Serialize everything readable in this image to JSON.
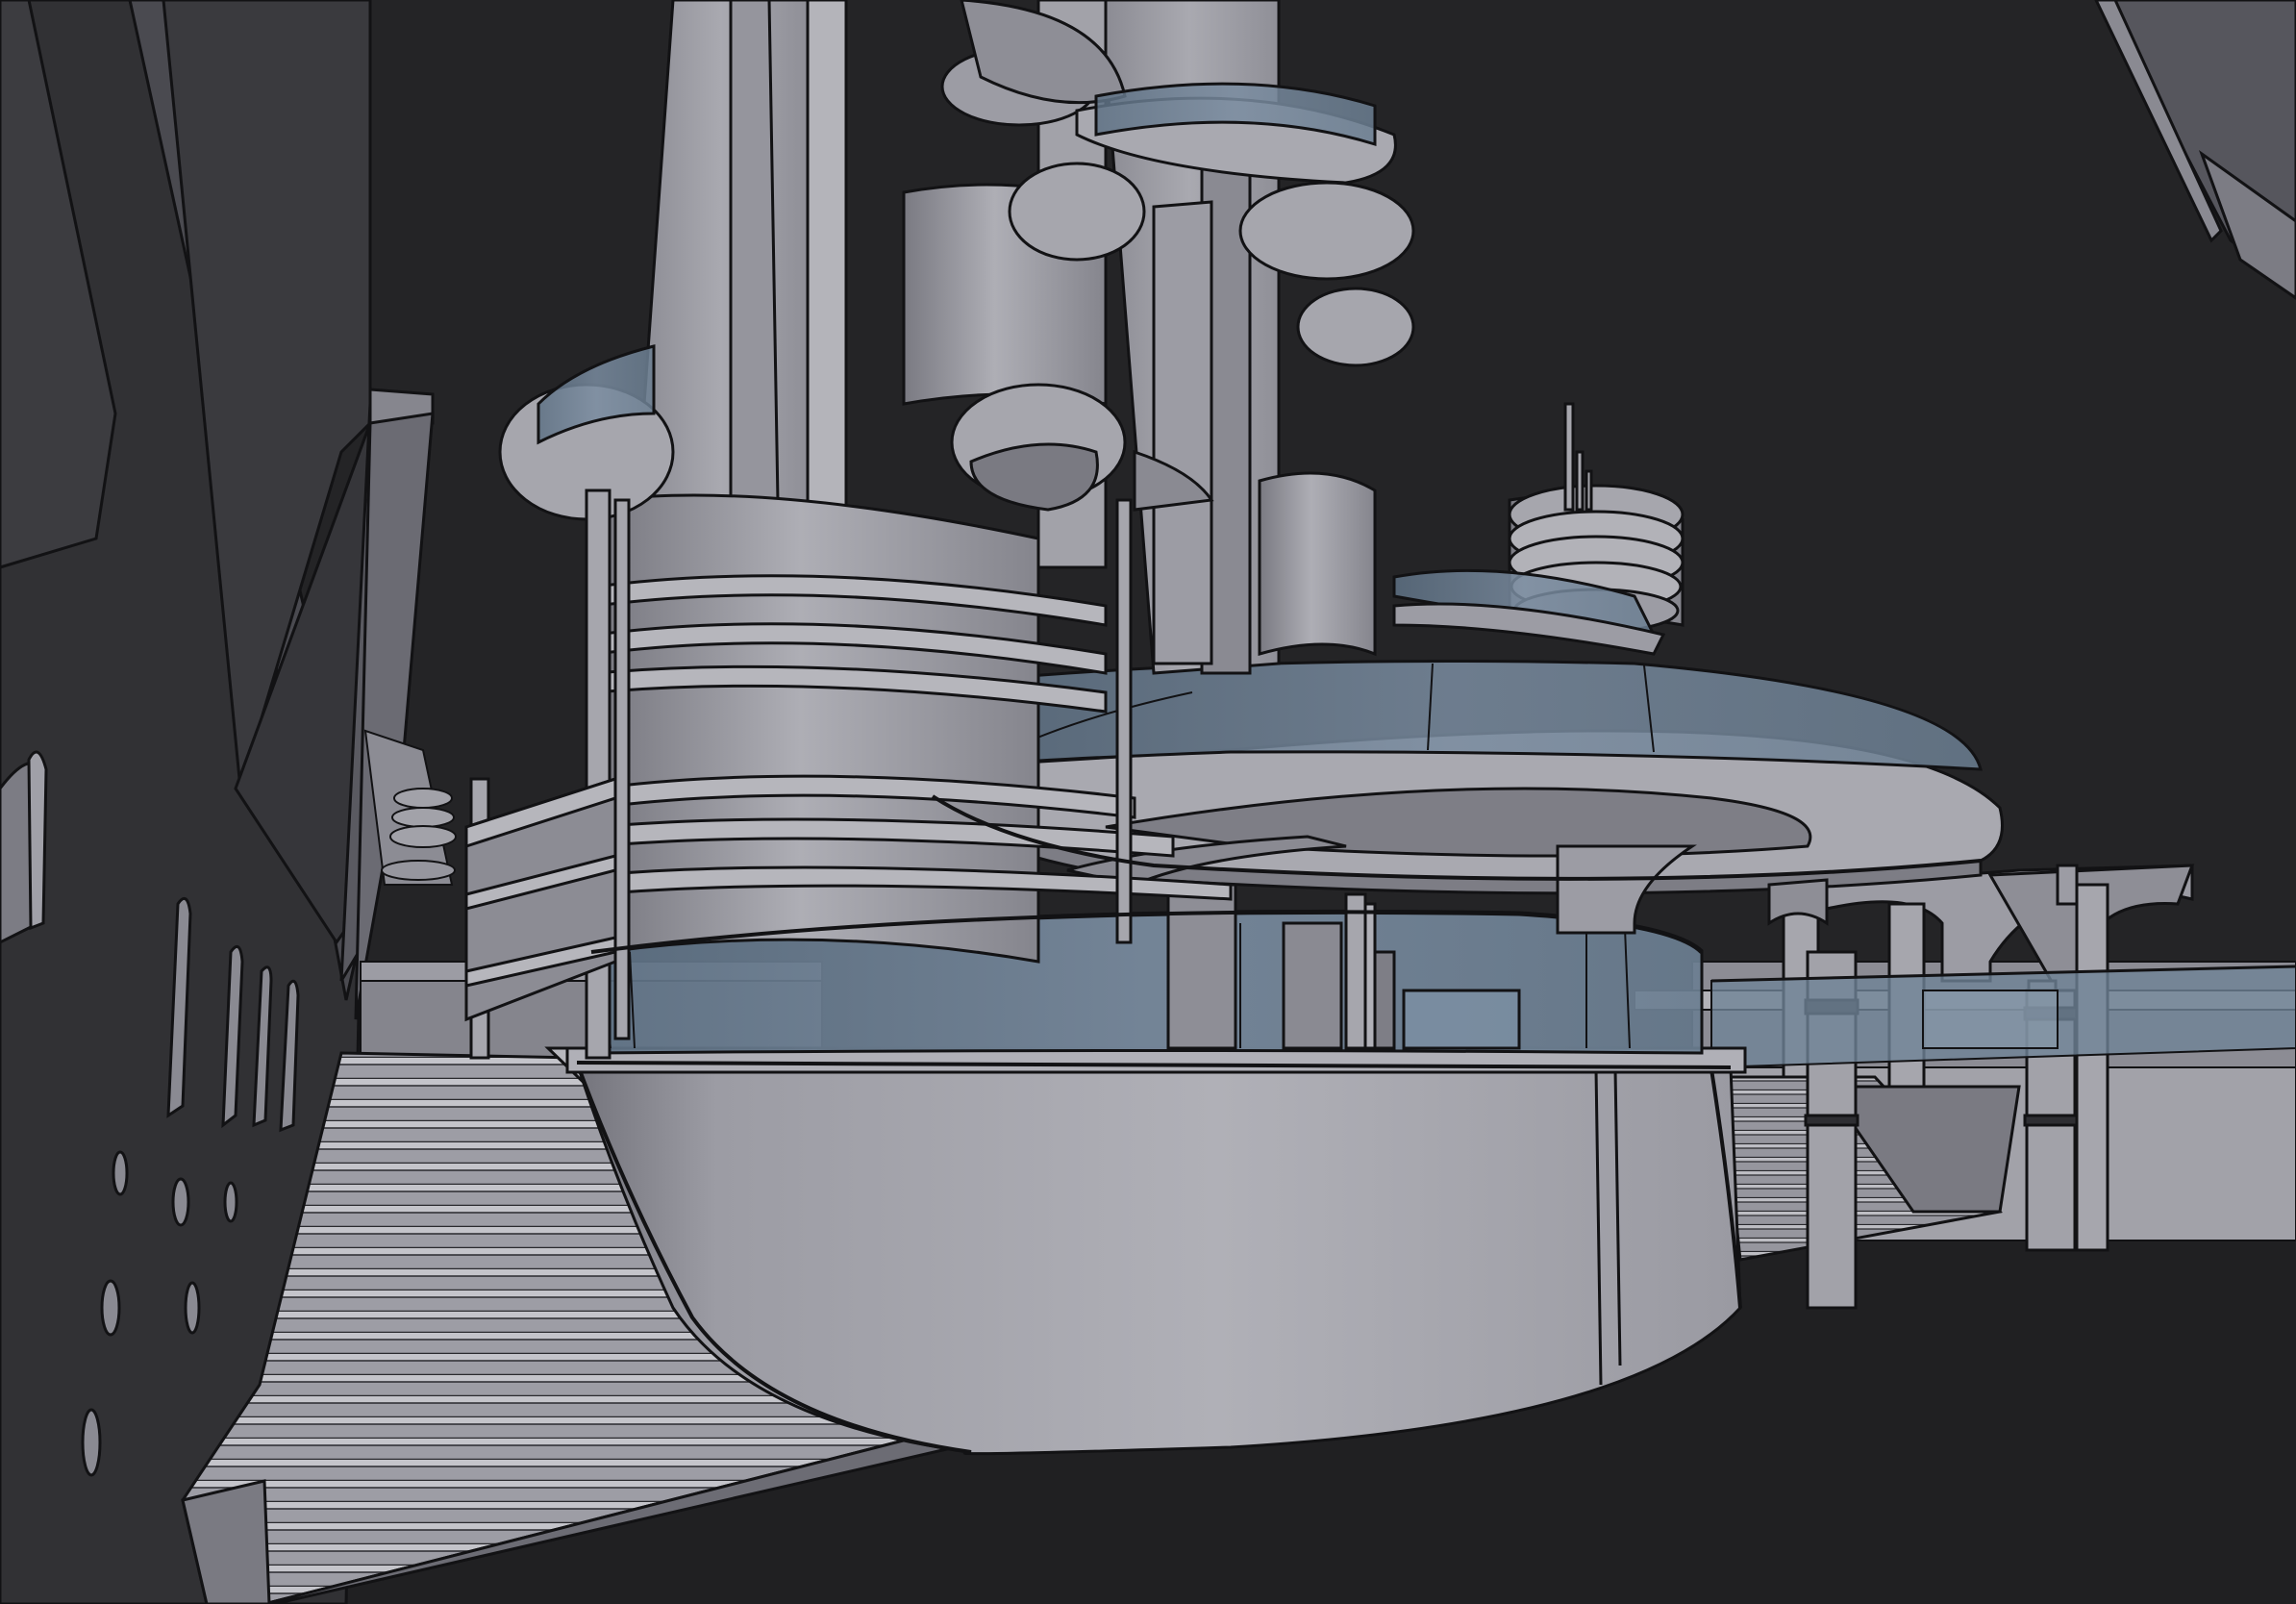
{
  "scene": {
    "caption": "",
    "colors": {
      "background": "#242426",
      "ground": "#222224",
      "wall_dark": "#363639",
      "wall_mid": "#57575e",
      "surface_light": "#a6a6ad",
      "surface_mid": "#8c8c94",
      "surface_shadow": "#6f6f77",
      "glass": "#6d8093",
      "glass_light": "#8797a7",
      "outline": "#121214"
    },
    "elements": [
      "left-building-wall",
      "arched-windows",
      "grand-staircase",
      "curved-podium-wall",
      "glass-balcony-railing",
      "upper-curved-deck",
      "central-tower",
      "cylindrical-columns",
      "circular-balconies",
      "antenna-spires",
      "right-colonnade",
      "right-staircase",
      "right-cantilevered-roof"
    ]
  }
}
